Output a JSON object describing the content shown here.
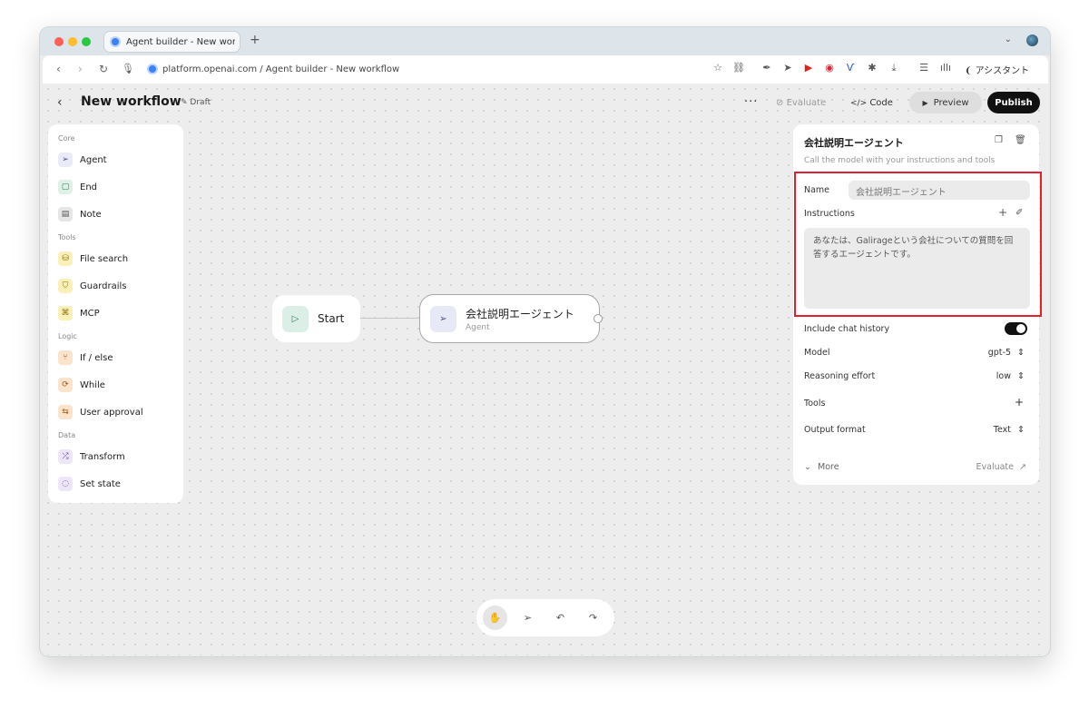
{
  "browser": {
    "tab_title": "Agent builder - New workflow",
    "url": "platform.openai.com / Agent builder - New workflow",
    "assistant_label": "アシスタント"
  },
  "header": {
    "title": "New workflow",
    "badge": "Draft",
    "evaluate": "Evaluate",
    "code": "Code",
    "preview": "Preview",
    "publish": "Publish"
  },
  "sidebar": {
    "sections": [
      {
        "label": "Core",
        "items": [
          "Agent",
          "End",
          "Note"
        ]
      },
      {
        "label": "Tools",
        "items": [
          "File search",
          "Guardrails",
          "MCP"
        ]
      },
      {
        "label": "Logic",
        "items": [
          "If / else",
          "While",
          "User approval"
        ]
      },
      {
        "label": "Data",
        "items": [
          "Transform",
          "Set state"
        ]
      }
    ]
  },
  "canvas": {
    "start_node": {
      "label": "Start"
    },
    "agent_node": {
      "name": "会社説明エージェント",
      "type": "Agent"
    }
  },
  "inspector": {
    "title": "会社説明エージェント",
    "subtitle": "Call the model with your instructions and tools",
    "name_label": "Name",
    "name_value": "会社説明エージェント",
    "instructions_label": "Instructions",
    "instructions_value": "あなたは、Galirageという会社についての質問を回答するエージェントです。",
    "include_chat_history_label": "Include chat history",
    "include_chat_history": true,
    "model_label": "Model",
    "model_value": "gpt-5",
    "reasoning_label": "Reasoning effort",
    "reasoning_value": "low",
    "tools_label": "Tools",
    "output_label": "Output format",
    "output_value": "Text",
    "more": "More",
    "evaluate": "Evaluate"
  },
  "colors": {
    "highlight": "#e4202e",
    "publish_bg": "#111111"
  }
}
